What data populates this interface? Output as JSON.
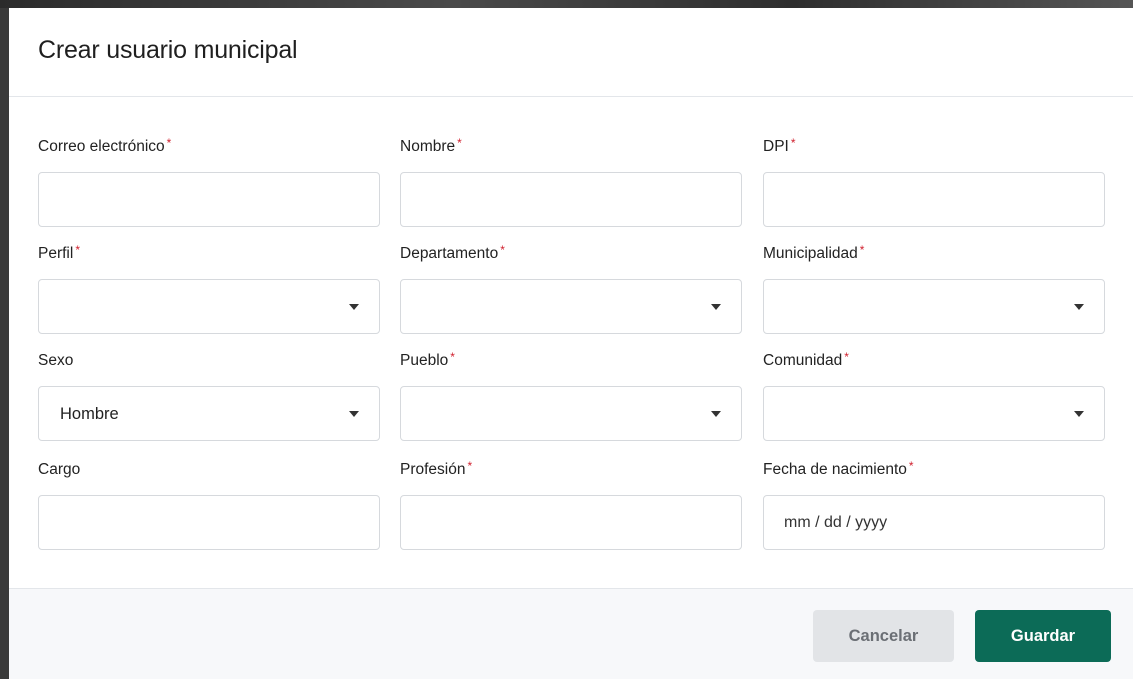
{
  "modal": {
    "title": "Crear usuario municipal",
    "required_mark": "*"
  },
  "fields": {
    "correo": {
      "label": "Correo electrónico",
      "value": ""
    },
    "nombre": {
      "label": "Nombre",
      "value": ""
    },
    "dpi": {
      "label": "DPI",
      "value": ""
    },
    "perfil": {
      "label": "Perfil",
      "selected": ""
    },
    "departamento": {
      "label": "Departamento",
      "selected": ""
    },
    "municipalidad": {
      "label": "Municipalidad",
      "selected": ""
    },
    "sexo": {
      "label": "Sexo",
      "selected": "Hombre"
    },
    "pueblo": {
      "label": "Pueblo",
      "selected": ""
    },
    "comunidad": {
      "label": "Comunidad",
      "selected": ""
    },
    "cargo": {
      "label": "Cargo",
      "value": ""
    },
    "profesion": {
      "label": "Profesión",
      "value": ""
    },
    "fecha_nacimiento": {
      "label": "Fecha de nacimiento",
      "placeholder": "mm / dd / yyyy"
    }
  },
  "footer": {
    "cancel_label": "Cancelar",
    "save_label": "Guardar"
  },
  "colors": {
    "primary": "#0c6b57",
    "required": "#d0202e",
    "cancel_bg": "#e2e4e7"
  },
  "icons": {
    "dropdown": "chevron-down-icon"
  }
}
